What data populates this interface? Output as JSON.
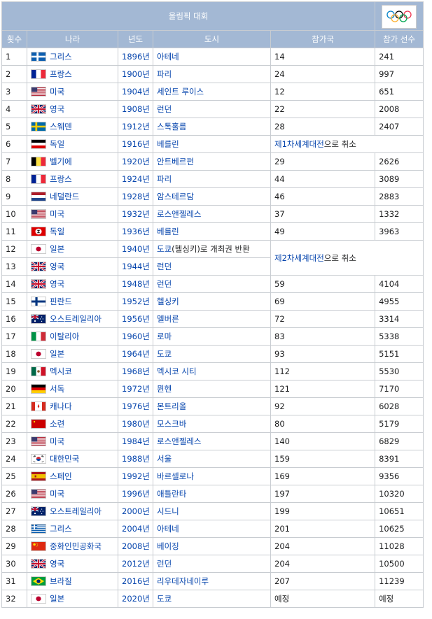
{
  "table": {
    "title": "올림픽 대회",
    "logo_alt": "olympic-rings",
    "headers": [
      "횟수",
      "나라",
      "년도",
      "도시",
      "참가국",
      "참가 선수"
    ],
    "rows": [
      {
        "no": "1",
        "flag": "greece-old",
        "country": "그리스",
        "year": "1896년",
        "city": "아테네",
        "nations": "14",
        "athletes": "241"
      },
      {
        "no": "2",
        "flag": "france",
        "country": "프랑스",
        "year": "1900년",
        "city": "파리",
        "nations": "24",
        "athletes": "997"
      },
      {
        "no": "3",
        "flag": "usa",
        "country": "미국",
        "year": "1904년",
        "city": "세인트 루이스",
        "nations": "12",
        "athletes": "651"
      },
      {
        "no": "4",
        "flag": "uk",
        "country": "영국",
        "year": "1908년",
        "city": "런던",
        "nations": "22",
        "athletes": "2008"
      },
      {
        "no": "5",
        "flag": "sweden",
        "country": "스웨덴",
        "year": "1912년",
        "city": "스톡홀름",
        "nations": "28",
        "athletes": "2407"
      },
      {
        "no": "6",
        "flag": "german-empire",
        "country": "독일",
        "year": "1916년",
        "city": "베를린",
        "note_link": "제1차세계대전",
        "note_text": "으로 취소"
      },
      {
        "no": "7",
        "flag": "belgium",
        "country": "벨기에",
        "year": "1920년",
        "city": "안트베르펀",
        "nations": "29",
        "athletes": "2626"
      },
      {
        "no": "8",
        "flag": "france",
        "country": "프랑스",
        "year": "1924년",
        "city": "파리",
        "nations": "44",
        "athletes": "3089"
      },
      {
        "no": "9",
        "flag": "netherlands",
        "country": "네덜란드",
        "year": "1928년",
        "city": "암스테르담",
        "nations": "46",
        "athletes": "2883"
      },
      {
        "no": "10",
        "flag": "usa",
        "country": "미국",
        "year": "1932년",
        "city": "로스앤젤레스",
        "nations": "37",
        "athletes": "1332"
      },
      {
        "no": "11",
        "flag": "nazi-germany",
        "country": "독일",
        "year": "1936년",
        "city": "베를린",
        "nations": "49",
        "athletes": "3963"
      },
      {
        "no": "12",
        "flag": "japan",
        "country": "일본",
        "year": "1940년",
        "city_link": "도쿄",
        "city_extra": "(헬싱키)로 개최권 반환",
        "note_link": "제2차세계대전",
        "note_text": "으로 취소"
      },
      {
        "no": "13",
        "flag": "uk",
        "country": "영국",
        "year": "1944년",
        "city": "런던"
      },
      {
        "no": "14",
        "flag": "uk",
        "country": "영국",
        "year": "1948년",
        "city": "런던",
        "nations": "59",
        "athletes": "4104"
      },
      {
        "no": "15",
        "flag": "finland",
        "country": "핀란드",
        "year": "1952년",
        "city": "헬싱키",
        "nations": "69",
        "athletes": "4955"
      },
      {
        "no": "16",
        "flag": "australia",
        "country": "오스트레일리아",
        "year": "1956년",
        "city": "멜버른",
        "nations": "72",
        "athletes": "3314"
      },
      {
        "no": "17",
        "flag": "italy",
        "country": "이탈리아",
        "year": "1960년",
        "city": "로마",
        "nations": "83",
        "athletes": "5338"
      },
      {
        "no": "18",
        "flag": "japan",
        "country": "일본",
        "year": "1964년",
        "city": "도쿄",
        "nations": "93",
        "athletes": "5151"
      },
      {
        "no": "19",
        "flag": "mexico",
        "country": "멕시코",
        "year": "1968년",
        "city": "멕시코 시티",
        "nations": "112",
        "athletes": "5530"
      },
      {
        "no": "20",
        "flag": "germany",
        "country": "서독",
        "year": "1972년",
        "city": "뮌헨",
        "nations": "121",
        "athletes": "7170"
      },
      {
        "no": "21",
        "flag": "canada",
        "country": "캐나다",
        "year": "1976년",
        "city": "몬트리올",
        "nations": "92",
        "athletes": "6028"
      },
      {
        "no": "22",
        "flag": "ussr",
        "country": "소련",
        "year": "1980년",
        "city": "모스크바",
        "nations": "80",
        "athletes": "5179"
      },
      {
        "no": "23",
        "flag": "usa",
        "country": "미국",
        "year": "1984년",
        "city": "로스앤젤레스",
        "nations": "140",
        "athletes": "6829"
      },
      {
        "no": "24",
        "flag": "korea",
        "country": "대한민국",
        "year": "1988년",
        "city": "서울",
        "nations": "159",
        "athletes": "8391"
      },
      {
        "no": "25",
        "flag": "spain",
        "country": "스페인",
        "year": "1992년",
        "city": "바르셀로나",
        "nations": "169",
        "athletes": "9356"
      },
      {
        "no": "26",
        "flag": "usa",
        "country": "미국",
        "year": "1996년",
        "city": "애틀란타",
        "nations": "197",
        "athletes": "10320"
      },
      {
        "no": "27",
        "flag": "australia",
        "country": "오스트레일리아",
        "year": "2000년",
        "city": "시드니",
        "nations": "199",
        "athletes": "10651"
      },
      {
        "no": "28",
        "flag": "greece",
        "country": "그리스",
        "year": "2004년",
        "city": "아테네",
        "nations": "201",
        "athletes": "10625"
      },
      {
        "no": "29",
        "flag": "china",
        "country": "중화인민공화국",
        "year": "2008년",
        "city": "베이징",
        "nations": "204",
        "athletes": "11028"
      },
      {
        "no": "30",
        "flag": "uk",
        "country": "영국",
        "year": "2012년",
        "city": "런던",
        "nations": "204",
        "athletes": "10500"
      },
      {
        "no": "31",
        "flag": "brazil",
        "country": "브라질",
        "year": "2016년",
        "city": "리우데자네이루",
        "nations": "207",
        "athletes": "11239"
      },
      {
        "no": "32",
        "flag": "japan",
        "country": "일본",
        "year": "2020년",
        "city": "도쿄",
        "nations": "예정",
        "athletes": "예정"
      }
    ]
  }
}
